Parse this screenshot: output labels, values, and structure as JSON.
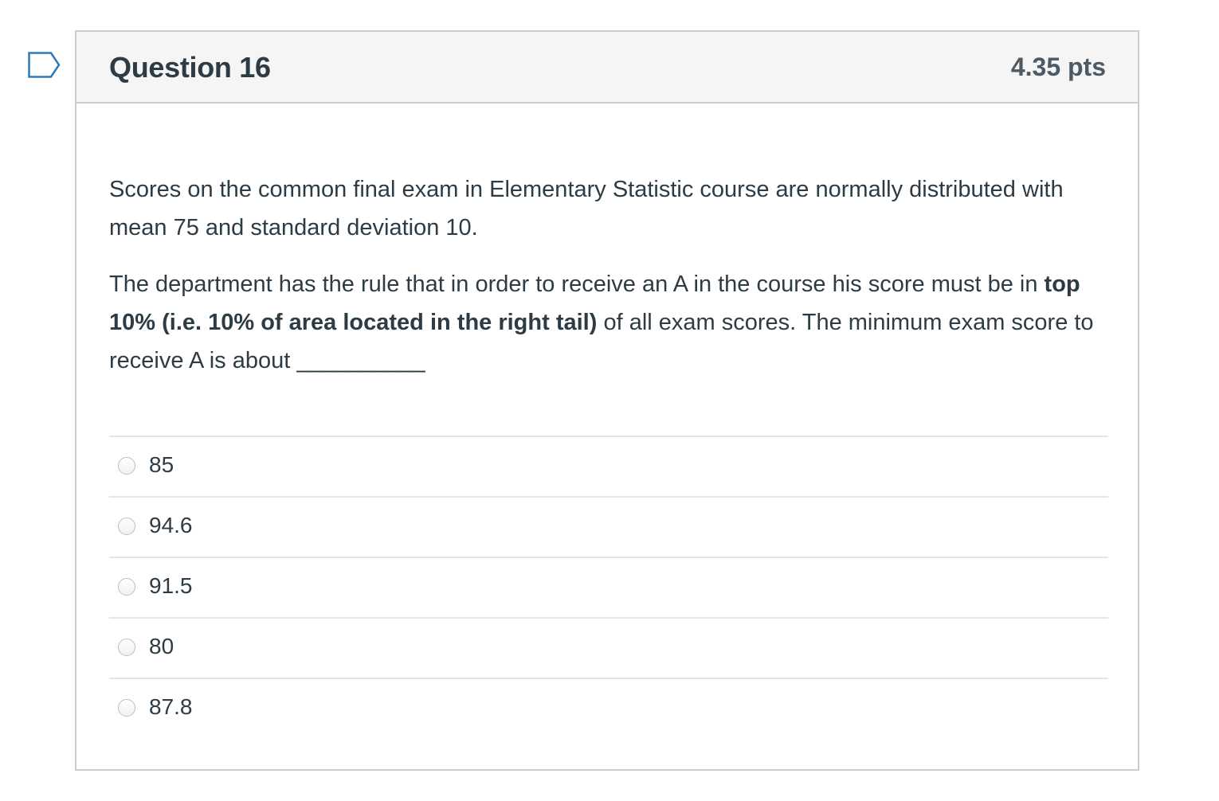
{
  "flag_icon": "bookmark-flag-icon",
  "question": {
    "title": "Question 16",
    "points": "4.35 pts",
    "paragraph1": "Scores on the common final  exam in Elementary Statistic course are normally distributed with mean 75 and standard deviation 10.",
    "paragraph2": {
      "before": "The department has the rule that in order to receive an A in the course his score must be in ",
      "bold": "top 10% (i.e. 10% of area located in the right tail)",
      "after": " of all exam scores. The minimum exam score to receive A is about __________"
    }
  },
  "answers": [
    {
      "label": "85",
      "selected": false
    },
    {
      "label": "94.6",
      "selected": false
    },
    {
      "label": "91.5",
      "selected": false
    },
    {
      "label": "80",
      "selected": false
    },
    {
      "label": "87.8",
      "selected": false
    }
  ],
  "colors": {
    "flag": "#2b7abc",
    "header_bg": "#f5f5f5",
    "border": "#c7cdd1",
    "text": "#2d3b45"
  }
}
